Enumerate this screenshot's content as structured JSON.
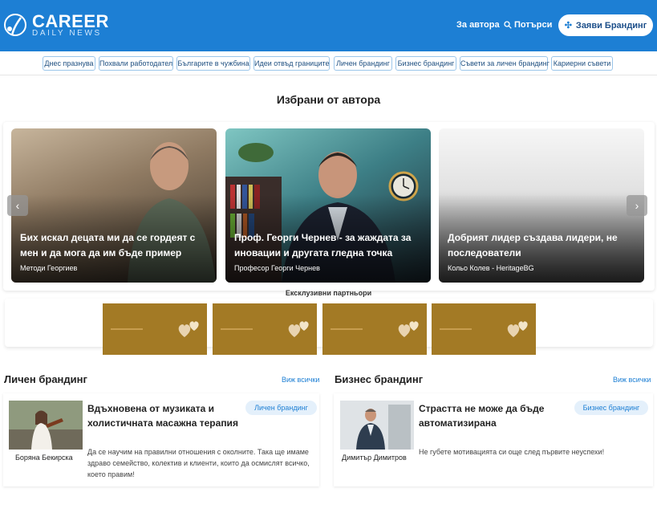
{
  "header": {
    "logo_title": "CAREER",
    "logo_subtitle": "DAILY NEWS",
    "nav_author": "За автора",
    "nav_search": "Потърси",
    "cta_label": "Заяви Брандинг",
    "colors": {
      "primary": "#1d7fd4",
      "cta_text": "#1d4f8a"
    }
  },
  "categories": [
    "Днес празнува",
    "Похвали работодател",
    "Българите в чужбина",
    "Идеи отвъд границите",
    "Личен брандинг",
    "Бизнес брандинг",
    "Съвети за личен брандинг",
    "Кариерни съвети"
  ],
  "featured": {
    "title": "Избрани от автора",
    "prev_icon": "chevron-left-icon",
    "next_icon": "chevron-right-icon",
    "cards": [
      {
        "title": "Бих искал децата ми да се гордеят с мен и да мога да им бъде пример",
        "author": "Методи Георгиев"
      },
      {
        "title": "Проф. Георги Чернев - за жаждата за иновации и другата гледна точка",
        "author": "Професор Георги Чернев"
      },
      {
        "title": "Добрият лидер създава лидери, не последователи",
        "author": "Кольо Колев - HeritageBG"
      }
    ]
  },
  "partners": {
    "label": "Ексклузивни партньори",
    "count_visible": 4,
    "color": "#a37a25"
  },
  "personal": {
    "heading": "Личен брандинг",
    "see_all": "Виж всички",
    "article": {
      "author": "Боряна Бекирска",
      "title": "Вдъхновена от музиката и холистичната масажна терапия",
      "tag": "Личен брандинг",
      "desc": "Да се научим на правилни отношения с околните. Така ще имаме здраво семейство, колектив и клиенти, които да осмислят всичко, което правим!"
    }
  },
  "business": {
    "heading": "Бизнес брандинг",
    "see_all": "Виж всички",
    "article": {
      "author": "Димитър Димитров",
      "title": "Страстта не може да бъде автоматизирана",
      "tag": "Бизнес брандинг",
      "desc": "Не губете мотивацията си още след първите неуспехи!"
    }
  }
}
